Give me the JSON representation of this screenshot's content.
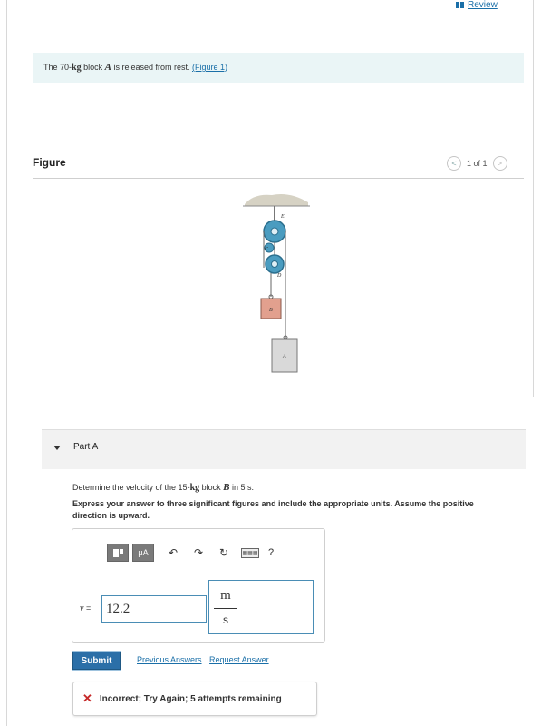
{
  "header": {
    "review_label": "Review",
    "review_icon": "book-icon"
  },
  "intro": {
    "text_before": "The 70-",
    "mass_unit": "kg",
    "text_mid": " block ",
    "block_name": "A",
    "text_after": " is released from rest. ",
    "figure_link": "(Figure 1)"
  },
  "figure": {
    "title": "Figure",
    "pager_text": "1 of 1",
    "labels": {
      "E": "E",
      "C": "C",
      "D": "D",
      "B": "B",
      "A": "A"
    }
  },
  "part": {
    "label": "Part A",
    "question_before": "Determine the velocity of the 15-",
    "question_unit": "kg",
    "question_mid": " block ",
    "question_block": "B",
    "question_after": " in 5 s.",
    "instruction": "Express your answer to three significant figures and include the appropriate units. Assume the positive direction is upward."
  },
  "answer": {
    "toolbar": {
      "units_button": "μA",
      "help": "?"
    },
    "variable": "v",
    "equals": " =",
    "value": "12.2",
    "unit_numerator": "m",
    "unit_denominator": "s"
  },
  "actions": {
    "submit": "Submit",
    "previous_answers": "Previous Answers",
    "request_answer": "Request Answer"
  },
  "feedback": {
    "text": "Incorrect; Try Again; 5 attempts remaining",
    "status_color": "#c62828"
  }
}
